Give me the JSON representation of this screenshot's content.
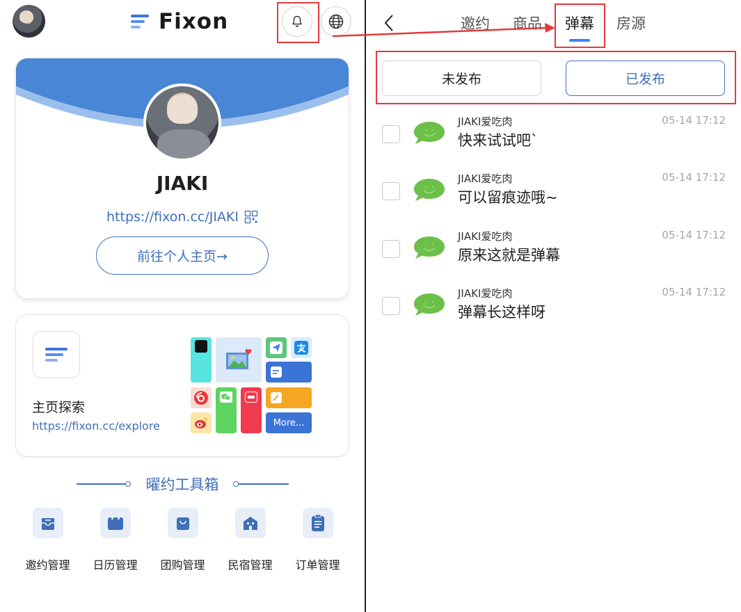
{
  "left": {
    "brand": "Fixon",
    "profile": {
      "name": "JIAKI",
      "url": "https://fixon.cc/JIAKI",
      "home_button": "前往个人主页→"
    },
    "explore": {
      "title": "主页探索",
      "url": "https://fixon.cc/explore",
      "more_tile": "More..."
    },
    "toolbox": {
      "title": "曜约工具箱",
      "items": [
        {
          "label": "邀约管理",
          "icon": "inbox-icon"
        },
        {
          "label": "日历管理",
          "icon": "calendar-icon"
        },
        {
          "label": "团购管理",
          "icon": "shopping-bag-icon"
        },
        {
          "label": "民宿管理",
          "icon": "building-icon"
        },
        {
          "label": "订单管理",
          "icon": "clipboard-icon"
        }
      ]
    }
  },
  "right": {
    "tabs": [
      {
        "label": "邀约",
        "active": false
      },
      {
        "label": "商品",
        "active": false
      },
      {
        "label": "弹幕",
        "active": true
      },
      {
        "label": "房源",
        "active": false
      }
    ],
    "filters": {
      "unpublished": "未发布",
      "published": "已发布",
      "selected": "published"
    },
    "danmaku": [
      {
        "user": "JIAKI爱吃肉",
        "time": "05-14 17:12",
        "text": "快来试试吧`"
      },
      {
        "user": "JIAKI爱吃肉",
        "time": "05-14 17:12",
        "text": "可以留痕迹哦~"
      },
      {
        "user": "JIAKI爱吃肉",
        "time": "05-14 17:12",
        "text": "原来这就是弹幕"
      },
      {
        "user": "JIAKI爱吃肉",
        "time": "05-14 17:12",
        "text": "弹幕长这样呀"
      }
    ]
  },
  "colors": {
    "accent_blue": "#3f6fb8",
    "highlight_red": "#e23a3a",
    "bubble_green": "#6cc04a",
    "tab_indicator": "#3b82f6"
  }
}
